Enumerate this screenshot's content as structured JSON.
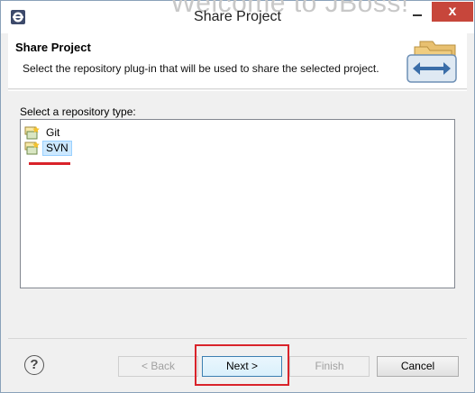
{
  "window": {
    "title": "Share Project",
    "background_text": "Welcome to JBoss!",
    "close_glyph": "x"
  },
  "header": {
    "title": "Share Project",
    "description": "Select the repository plug-in that will be used to share the selected project."
  },
  "repository": {
    "label": "Select a repository type:",
    "items": [
      {
        "label": "Git",
        "icon": "git-repo-icon",
        "selected": false
      },
      {
        "label": "SVN",
        "icon": "svn-repo-icon",
        "selected": true
      }
    ]
  },
  "buttons": {
    "help": "?",
    "back": "< Back",
    "next": "Next >",
    "finish": "Finish",
    "cancel": "Cancel"
  },
  "colors": {
    "accent": "#3c7fb1",
    "highlight": "#d9232a",
    "close": "#c7463b",
    "selection": "#cce8ff"
  }
}
